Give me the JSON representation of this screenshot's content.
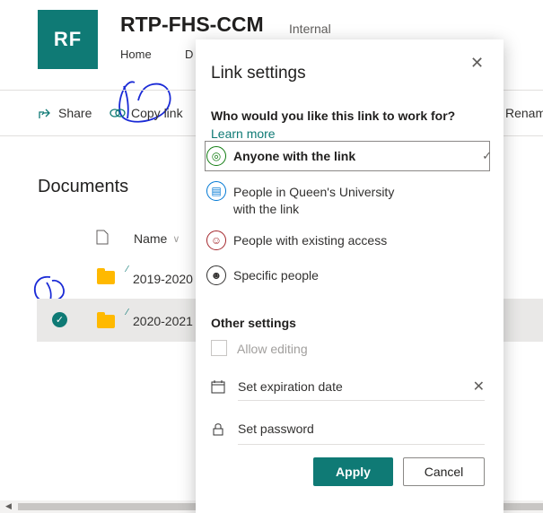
{
  "site": {
    "logo_initials": "RF",
    "title": "RTP-FHS-CCM",
    "badge": "Internal"
  },
  "nav": {
    "home": "Home",
    "documents_partial": "D"
  },
  "command_bar": {
    "share": "Share",
    "copy_link": "Copy link",
    "rename_partial": "Renam"
  },
  "documents": {
    "title": "Documents",
    "name_header": "Name",
    "rows": [
      {
        "name": "2019-2020",
        "selected": false
      },
      {
        "name": "2020-2021",
        "selected": true
      }
    ]
  },
  "panel": {
    "title": "Link settings",
    "question": "Who would you like this link to work for?",
    "learn_more": "Learn more",
    "options": [
      {
        "line1": "Anyone with the link",
        "line2": "",
        "icon": "globe-icon",
        "selected": true
      },
      {
        "line1": "People in Queen's University",
        "line2": "with the link",
        "icon": "building-icon",
        "selected": false
      },
      {
        "line1": "People with existing access",
        "line2": "",
        "icon": "people-icon",
        "selected": false
      },
      {
        "line1": "Specific people",
        "line2": "",
        "icon": "person-add-icon",
        "selected": false
      }
    ],
    "other_settings": "Other settings",
    "allow_editing": "Allow editing",
    "expiration_placeholder": "Set expiration date",
    "password_placeholder": "Set password",
    "apply": "Apply",
    "cancel": "Cancel"
  },
  "colors": {
    "brand": "#0f7a75",
    "globe": "#107c10",
    "org": "#0078d4",
    "existing": "#a4262c"
  }
}
